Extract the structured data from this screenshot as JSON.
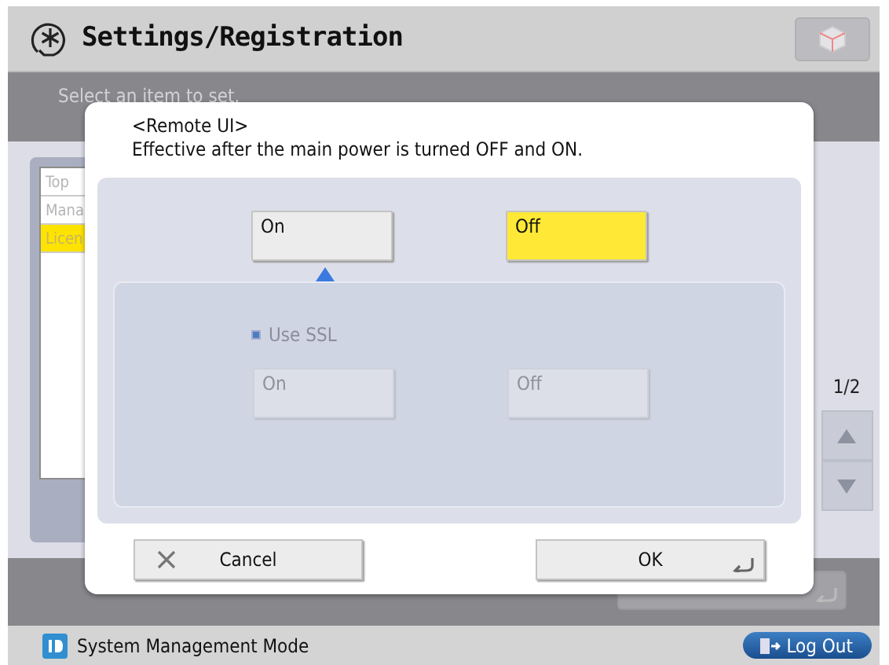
{
  "header": {
    "title": "Settings/Registration"
  },
  "instruction": "Select an item to set.",
  "list": {
    "items": [
      {
        "label": "Top",
        "selected": false
      },
      {
        "label": "Mana",
        "selected": false
      },
      {
        "label": "Licen",
        "selected": true
      }
    ]
  },
  "page_indicator": "1/2",
  "dialog": {
    "title": "<Remote UI>",
    "message": "Effective after the main power is turned OFF and ON.",
    "options": [
      {
        "label": "On",
        "selected": false
      },
      {
        "label": "Off",
        "selected": true
      }
    ],
    "sub_setting": {
      "label": "Use SSL",
      "disabled": true,
      "options": [
        {
          "label": "On",
          "selected": false
        },
        {
          "label": "Off",
          "selected": false
        }
      ]
    },
    "buttons": [
      {
        "kind": "cancel",
        "label": "Cancel"
      },
      {
        "kind": "ok",
        "label": "OK"
      }
    ]
  },
  "status_bar": {
    "mode": "System Management Mode",
    "logout": "Log Out"
  }
}
